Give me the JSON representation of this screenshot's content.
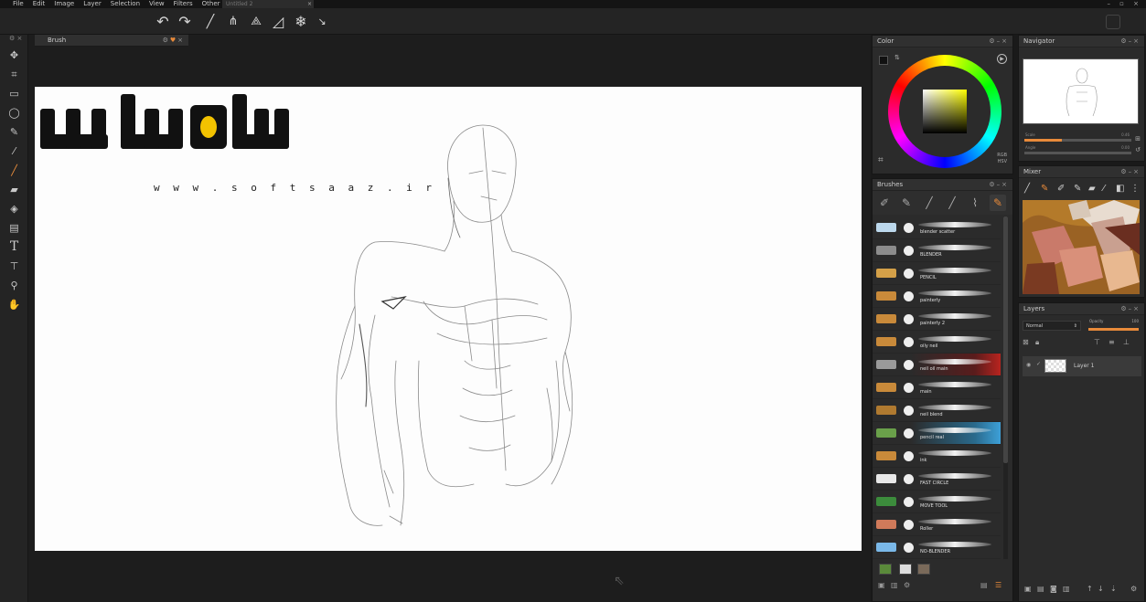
{
  "menu": [
    "File",
    "Edit",
    "Image",
    "Layer",
    "Selection",
    "View",
    "Filters",
    "Other"
  ],
  "document_tab": {
    "title": "Untitled 2",
    "close": "×"
  },
  "window_controls": "– ▫ ×",
  "toolbar": {
    "undo_icon": "undo-icon",
    "redo_icon": "redo-icon",
    "tools": [
      "brush",
      "symmetry",
      "perspective",
      "ruler",
      "triangle",
      "kaleidoscope",
      "knife"
    ]
  },
  "left_tools": [
    "move",
    "crop",
    "rect-select",
    "lasso",
    "wand",
    "eyedropper",
    "brush",
    "eraser",
    "fill",
    "gradient",
    "text",
    "paint-roller",
    "zoom",
    "hand"
  ],
  "brush_panel": {
    "title": "Brush"
  },
  "watermark": {
    "arabic": "سافت ساز",
    "url": "w w w . s o f t s a a z . i r"
  },
  "color_panel": {
    "title": "Color",
    "modes": [
      "RGB",
      "HSV"
    ],
    "accent": "#e88a3a"
  },
  "brushes_panel": {
    "title": "Brushes",
    "items": [
      {
        "name": "blender scatter",
        "color": "#bcd8ec"
      },
      {
        "name": "BLENDER",
        "color": "#8c8c8c"
      },
      {
        "name": "PENCIL",
        "color": "#d4a048"
      },
      {
        "name": "painterly",
        "color": "#c98a3a"
      },
      {
        "name": "painterly 2",
        "color": "#c98a3a"
      },
      {
        "name": "oily neil",
        "color": "#c98a3a"
      },
      {
        "name": "neil oil main",
        "color": "#9a9a9a"
      },
      {
        "name": "main",
        "color": "#c98a3a"
      },
      {
        "name": "neil blend",
        "color": "#b07a30"
      },
      {
        "name": "pencil real",
        "color": "#6aa04a"
      },
      {
        "name": "ink",
        "color": "#c98a3a"
      },
      {
        "name": "FAST CIRCLE",
        "color": "#e8e8e8"
      },
      {
        "name": "MOVE TOOL",
        "color": "#3c8c3c"
      },
      {
        "name": "Roller",
        "color": "#d07a5a"
      },
      {
        "name": "NO-BLENDER",
        "color": "#7ab8e8"
      }
    ]
  },
  "navigator_panel": {
    "title": "Navigator",
    "scale_label": "Scale",
    "scale_value": "0.46",
    "scale_fraction": 0.35,
    "angle_label": "Angle",
    "angle_value": "0.00",
    "angle_fraction": 0.0
  },
  "mixer_panel": {
    "title": "Mixer"
  },
  "layers_panel": {
    "title": "Layers",
    "blend_mode": "Normal",
    "opacity_label": "Opacity",
    "opacity_value": "100",
    "layer_name": "Layer 1"
  }
}
